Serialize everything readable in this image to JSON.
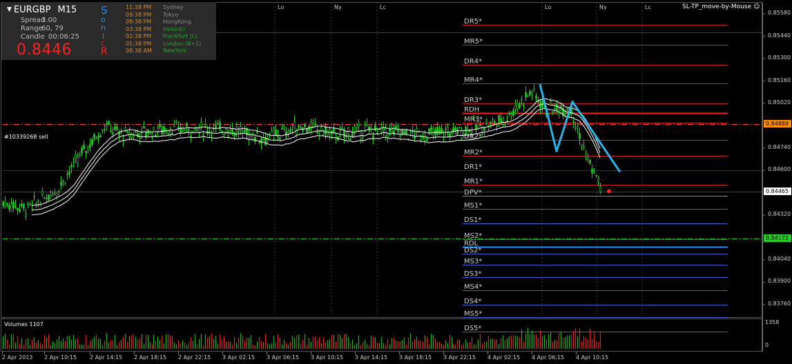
{
  "info_panel": {
    "symbol": "EURGBP",
    "timeframe": "M15",
    "spread_label": "Spread",
    "spread_value": "3.00",
    "range_label": "Range",
    "range_value": "60, 79",
    "candle_label": "Candle",
    "candle_value": "00:06:25",
    "price": "0.8446",
    "sonic_letters": [
      "S",
      "o",
      "n",
      "i",
      "c"
    ],
    "sonic_last": "R"
  },
  "sessions": [
    {
      "time": "11:38 PM",
      "name": "Sydney",
      "color": "#8a8a8a"
    },
    {
      "time": "09:38 PM",
      "name": "Tokyo",
      "color": "#8a8a8a"
    },
    {
      "time": "08:38 PM",
      "name": "HongKong",
      "color": "#8a8a8a"
    },
    {
      "time": "03:38 PM",
      "name": "Helsinki",
      "color": "#2fa12f"
    },
    {
      "time": "02:38 PM",
      "name": "Frankfurt  (L)",
      "color": "#2fa12f"
    },
    {
      "time": "01:38 PM",
      "name": "London  (B+1)",
      "color": "#2fa12f"
    },
    {
      "time": "08:38 AM",
      "name": "NewYork",
      "color": "#2fa12f"
    }
  ],
  "session_time_color": "#d48a2a",
  "indicator_title": "SL-TP_move-by-Mouse",
  "session_markers": [
    "Lo",
    "Ny",
    "Lc",
    "Lo",
    "Ny",
    "Lc"
  ],
  "trade_label": "#10339268 sell",
  "price_scale": [
    "0.85580",
    "0.85440",
    "0.85300",
    "0.85160",
    "0.85020",
    "0.84740",
    "0.84600",
    "0.84320",
    "0.84040",
    "0.83900",
    "0.83760"
  ],
  "price_tags": [
    {
      "label": "0.84889",
      "bg": "#ff8c00",
      "fg": "#000000"
    },
    {
      "label": "0.84465",
      "bg": "#ffffff",
      "fg": "#000000"
    },
    {
      "label": "0.84172",
      "bg": "#22cc22",
      "fg": "#000000"
    }
  ],
  "pivot_levels": [
    "DR5*",
    "MR5*",
    "DR4*",
    "MR4*",
    "DR3*",
    "RDH",
    "MR3*",
    "DR2*",
    "MR2*",
    "DR1*",
    "MR1*",
    "DPV*",
    "MS1*",
    "DS1*",
    "MS2*",
    "RDL",
    "DS2*",
    "MS3*",
    "DS3*",
    "MS4*",
    "DS4*",
    "MS5*",
    "DS5*"
  ],
  "volume_title": "Volumes 1107",
  "volume_scale": [
    "1358",
    "0"
  ],
  "time_axis": [
    "2 Apr 2013",
    "2 Apr 10:15",
    "2 Apr 14:15",
    "2 Apr 18:15",
    "2 Apr 22:15",
    "3 Apr 02:15",
    "3 Apr 06:15",
    "3 Apr 10:15",
    "3 Apr 14:15",
    "3 Apr 18:15",
    "3 Apr 22:15",
    "4 Apr 02:15",
    "4 Apr 06:15",
    "4 Apr 10:15"
  ],
  "colors": {
    "candle": "#22cc22",
    "ma": "#ffffff",
    "trend": "#26b5e8",
    "vol_up": "#22aa22",
    "vol_down": "#dd2222",
    "resist": "#cc2222",
    "support": "#3a62d8",
    "pivot_mid": "#8c8c48"
  },
  "chart_data": {
    "type": "candlestick",
    "symbol": "EURGBP",
    "timeframe": "M15",
    "ylim": [
      0.8369,
      0.8565
    ],
    "levels": {
      "DR5*": 0.8551,
      "MR5*": 0.85385,
      "DR4*": 0.8526,
      "MR4*": 0.85145,
      "DR3*": 0.8502,
      "RDH": 0.8496,
      "MR3*": 0.849,
      "DR2*": 0.8479,
      "MR2*": 0.8469,
      "DR1*": 0.846,
      "MR1*": 0.8451,
      "DPV*": 0.8444,
      "MS1*": 0.8436,
      "DS1*": 0.8427,
      "MS2*": 0.8417,
      "RDL": 0.8412,
      "DS2*": 0.8408,
      "MS3*": 0.8401,
      "DS3*": 0.8393,
      "MS4*": 0.8385,
      "DS4*": 0.8376,
      "MS5*": 0.8368,
      "DS5*": 0.8359
    },
    "trade_price": 0.84889,
    "bid": 0.84465,
    "target": 0.84172,
    "volume_max": 1358,
    "trend_points": [
      [
        0.8514,
        0
      ],
      [
        0.8488,
        0.07
      ],
      [
        0.8503,
        0.14
      ],
      [
        0.8459,
        0.36
      ]
    ]
  }
}
